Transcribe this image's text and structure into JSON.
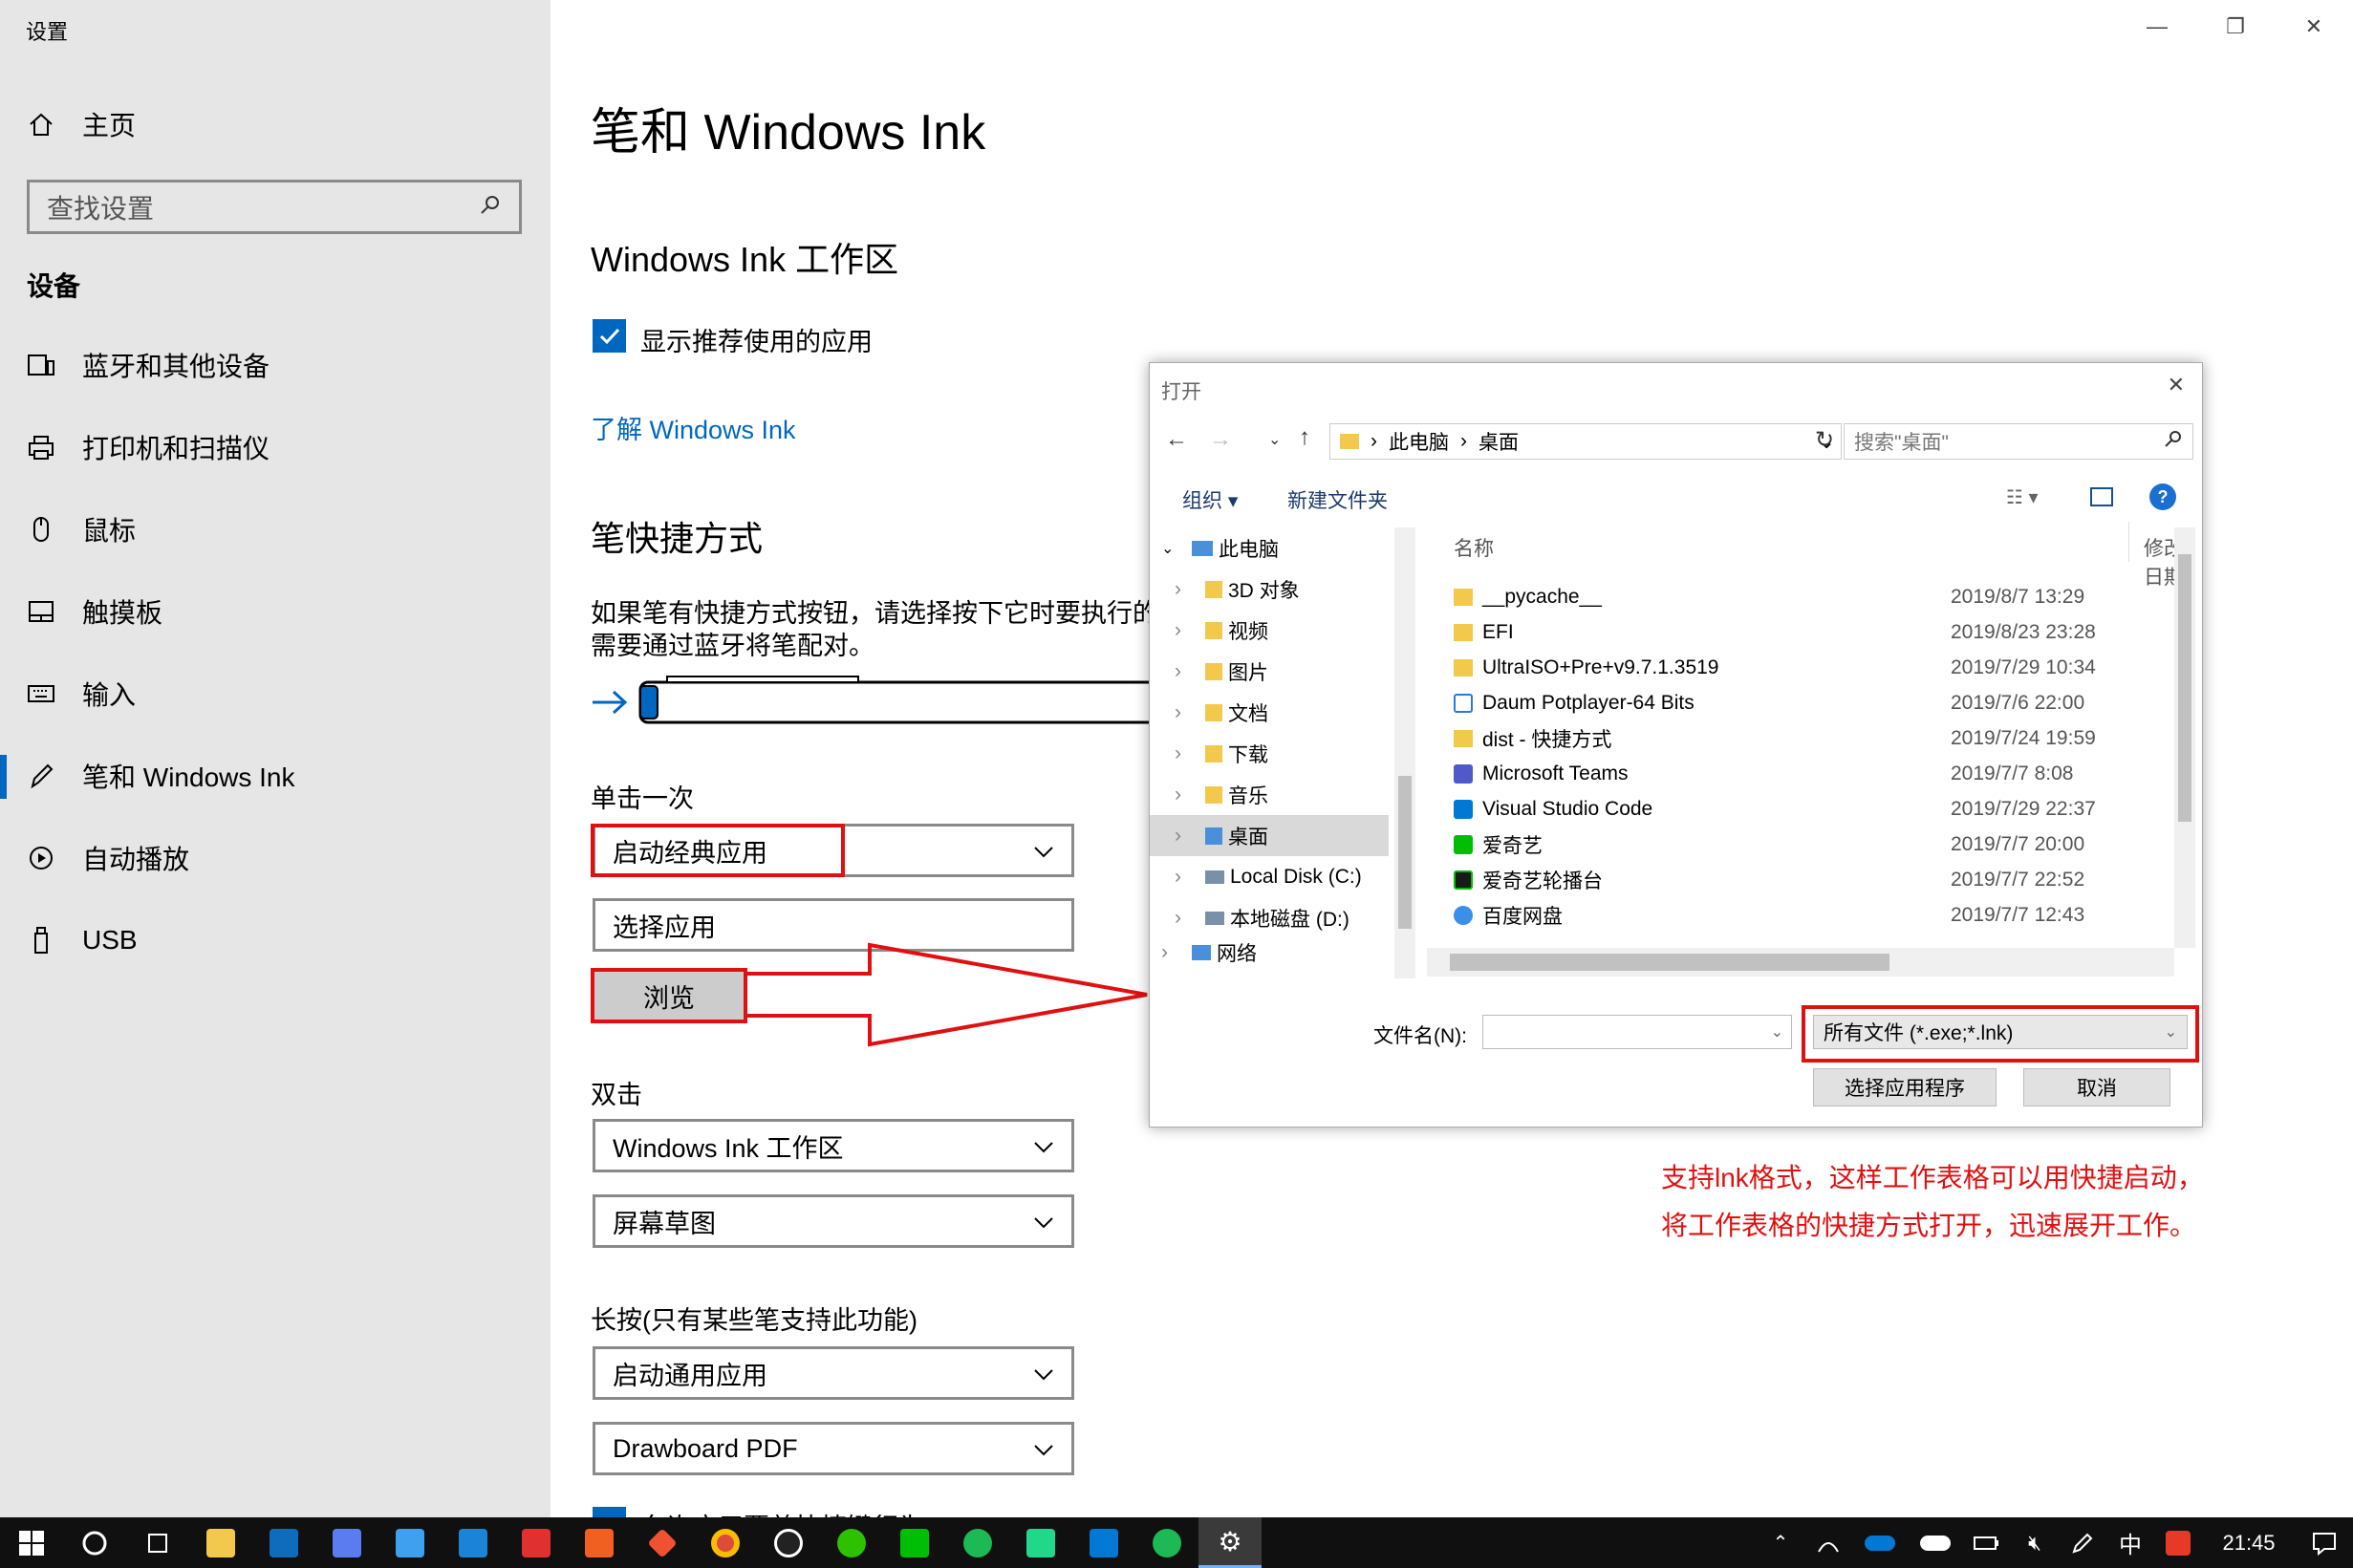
{
  "window": {
    "title": "设置",
    "minimize": "—",
    "restore": "❐",
    "close": "✕"
  },
  "sidebar": {
    "home": "主页",
    "search_placeholder": "查找设置",
    "section": "设备",
    "items": [
      {
        "label": "蓝牙和其他设备",
        "icon": "bluetooth-devices-icon"
      },
      {
        "label": "打印机和扫描仪",
        "icon": "printer-icon"
      },
      {
        "label": "鼠标",
        "icon": "mouse-icon"
      },
      {
        "label": "触摸板",
        "icon": "touchpad-icon"
      },
      {
        "label": "输入",
        "icon": "keyboard-icon"
      },
      {
        "label": "笔和 Windows Ink",
        "icon": "pen-icon"
      },
      {
        "label": "自动播放",
        "icon": "autoplay-icon"
      },
      {
        "label": "USB",
        "icon": "usb-icon"
      }
    ]
  },
  "main": {
    "title": "笔和 Windows Ink",
    "ink_section": "Windows Ink 工作区",
    "show_apps_checkbox": "显示推荐使用的应用",
    "learn_link": "了解 Windows Ink",
    "shortcut_section": "笔快捷方式",
    "shortcut_desc_1": "如果笔有快捷方式按钮，请选择按下它时要执行的",
    "shortcut_desc_2": "需要通过蓝牙将笔配对。",
    "single_click": "单击一次",
    "single_click_value": "启动经典应用",
    "choose_app": "选择应用",
    "browse_button": "浏览",
    "double_click": "双击",
    "double_click_value": "Windows Ink 工作区",
    "double_click_value2": "屏幕草图",
    "long_press": "长按(只有某些笔支持此功能)",
    "long_press_value": "启动通用应用",
    "long_press_value2": "Drawboard PDF",
    "bottom_partial": "允许应用覆盖快捷键行为"
  },
  "dialog": {
    "title": "打开",
    "close": "✕",
    "breadcrumb": [
      "此电脑",
      "桌面"
    ],
    "search_placeholder": "搜索\"桌面\"",
    "organize": "组织 ▾",
    "new_folder": "新建文件夹",
    "col_name": "名称",
    "col_date": "修改日期",
    "tree": [
      "此电脑",
      "3D 对象",
      "视频",
      "图片",
      "文档",
      "下载",
      "音乐",
      "桌面",
      "Local Disk (C:)",
      "本地磁盘 (D:)",
      "网络"
    ],
    "files": [
      {
        "name": "__pycache__",
        "date": "2019/8/7 13:29",
        "icon": "folder-icon"
      },
      {
        "name": "EFI",
        "date": "2019/8/23 23:28",
        "icon": "folder-icon"
      },
      {
        "name": "UltraISO+Pre+v9.7.1.3519",
        "date": "2019/7/29 10:34",
        "icon": "folder-icon"
      },
      {
        "name": "Daum Potplayer-64 Bits",
        "date": "2019/7/6 22:00",
        "icon": "potplayer-icon"
      },
      {
        "name": "dist - 快捷方式",
        "date": "2019/7/24 19:59",
        "icon": "folder-shortcut-icon"
      },
      {
        "name": "Microsoft Teams",
        "date": "2019/7/7 8:08",
        "icon": "teams-icon"
      },
      {
        "name": "Visual Studio Code",
        "date": "2019/7/29 22:37",
        "icon": "vscode-icon"
      },
      {
        "name": "爱奇艺",
        "date": "2019/7/7 20:00",
        "icon": "iqiyi-icon"
      },
      {
        "name": "爱奇艺轮播台",
        "date": "2019/7/7 22:52",
        "icon": "iqiyi-carousel-icon"
      },
      {
        "name": "百度网盘",
        "date": "2019/7/7 12:43",
        "icon": "baidu-netdisk-icon"
      }
    ],
    "filename_label": "文件名(N):",
    "filename_value": "",
    "filetype": "所有文件 (*.exe;*.lnk)",
    "select_button": "选择应用程序",
    "cancel_button": "取消"
  },
  "annotation": {
    "line1": "支持lnk格式，这样工作表格可以用快捷启动，",
    "line2": "将工作表格的快捷方式打开，迅速展开工作。"
  },
  "taskbar": {
    "clock": "21:45",
    "ime": "中",
    "colors": {
      "accent": "#0067c0",
      "annotation": "#e01010"
    }
  }
}
